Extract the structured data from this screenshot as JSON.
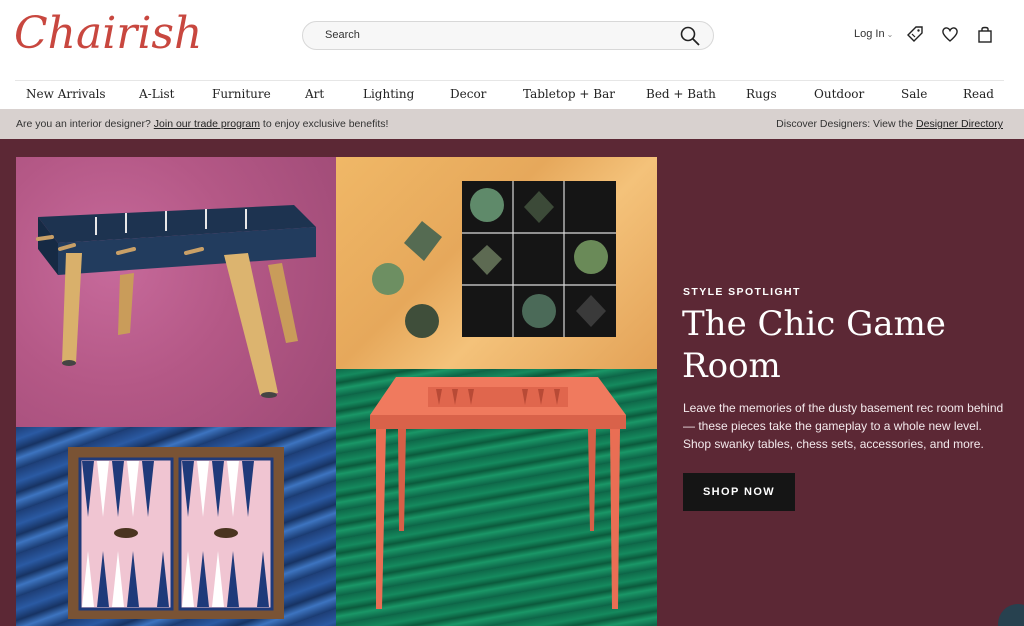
{
  "brand": {
    "logo": "Chairish",
    "accent": "#c8473f"
  },
  "search": {
    "placeholder": "Search"
  },
  "header": {
    "login": "Log In",
    "icons": [
      "tag-icon",
      "heart-icon",
      "bag-icon"
    ]
  },
  "nav": [
    "New Arrivals",
    "A-List",
    "Furniture",
    "Art",
    "Lighting",
    "Decor",
    "Tabletop + Bar",
    "Bed + Bath",
    "Rugs",
    "Outdoor",
    "Sale",
    "Read"
  ],
  "banner": {
    "left_prefix": "Are you an interior designer?",
    "left_link": "Join our trade program",
    "left_suffix": "to enjoy exclusive benefits!",
    "right_prefix": "Discover Designers: View the",
    "right_link": "Designer Directory"
  },
  "hero": {
    "label": "STYLE SPOTLIGHT",
    "title": "The Chic Game Room",
    "body": "Leave the memories of the dusty basement rec room behind — these pieces take the gameplay to a whole new level. Shop swanky tables, chess sets, accessories, and more.",
    "button": "SHOP NOW",
    "background": "#5c2835"
  }
}
